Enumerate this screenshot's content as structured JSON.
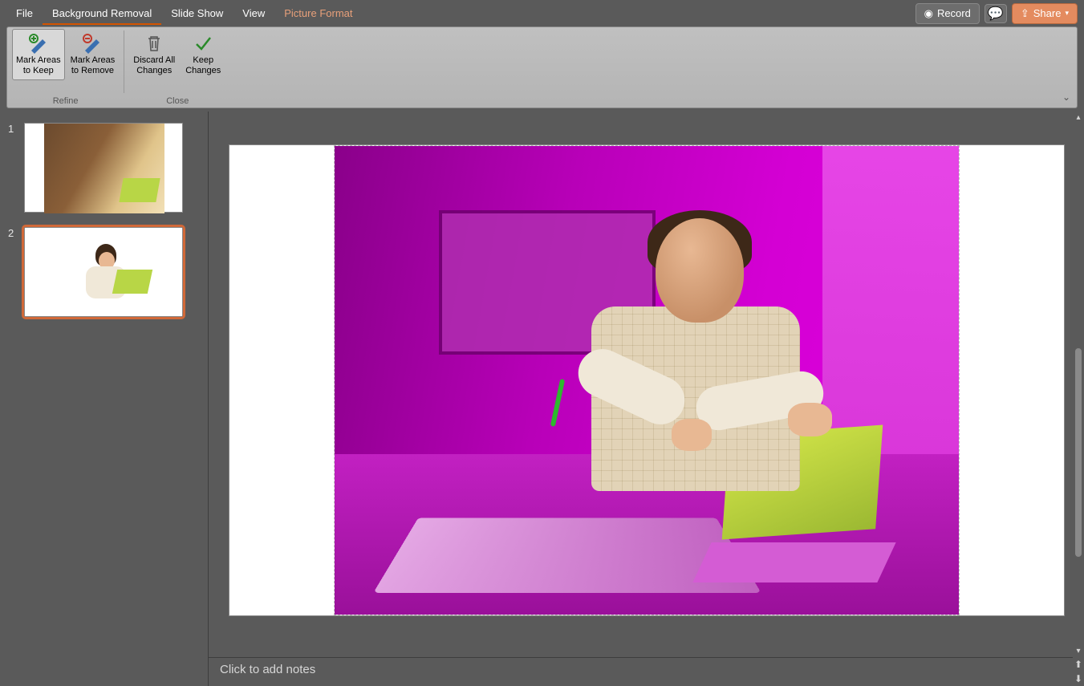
{
  "tabs": {
    "file": "File",
    "background_removal": "Background Removal",
    "slide_show": "Slide Show",
    "view": "View",
    "picture_format": "Picture Format"
  },
  "topright": {
    "record": "Record",
    "share": "Share"
  },
  "ribbon": {
    "mark_keep_l1": "Mark Areas",
    "mark_keep_l2": "to Keep",
    "mark_remove_l1": "Mark Areas",
    "mark_remove_l2": "to Remove",
    "discard_l1": "Discard All",
    "discard_l2": "Changes",
    "keep_l1": "Keep",
    "keep_l2": "Changes",
    "group_refine": "Refine",
    "group_close": "Close"
  },
  "thumbs": {
    "n1": "1",
    "n2": "2"
  },
  "notes_placeholder": "Click to add notes"
}
